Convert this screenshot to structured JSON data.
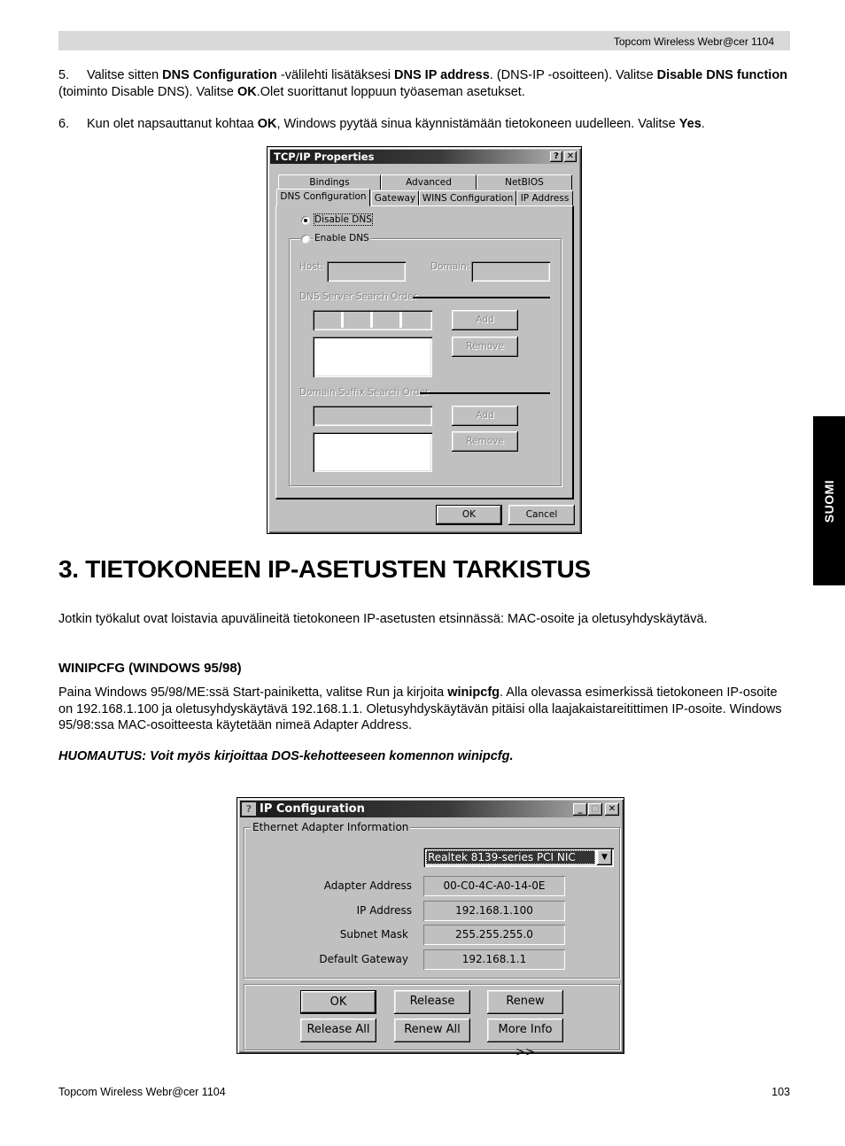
{
  "header": {
    "text": "Topcom Wireless Webr@cer 1104"
  },
  "side_tab": {
    "label": "SUOMI"
  },
  "steps": [
    {
      "number": "5.",
      "parts": [
        {
          "t": "Valitse sitten ",
          "b": false
        },
        {
          "t": "DNS Configuration",
          "b": true
        },
        {
          "t": " -välilehti lisätäksesi ",
          "b": false
        },
        {
          "t": "DNS IP address",
          "b": true
        },
        {
          "t": ". (DNS-IP -osoitteen). Valitse ",
          "b": false
        },
        {
          "t": "Disable DNS function",
          "b": true
        },
        {
          "t": " (toiminto Disable DNS). Valitse ",
          "b": false
        },
        {
          "t": "OK",
          "b": true
        },
        {
          "t": ".Olet suorittanut loppuun työaseman asetukset.",
          "b": false
        }
      ]
    },
    {
      "number": "6.",
      "parts": [
        {
          "t": "Kun olet napsauttanut kohtaa ",
          "b": false
        },
        {
          "t": "OK",
          "b": true
        },
        {
          "t": ", Windows pyytää sinua käynnistämään tietokoneen uudelleen. Valitse ",
          "b": false
        },
        {
          "t": "Yes",
          "b": true
        },
        {
          "t": ".",
          "b": false
        }
      ]
    }
  ],
  "tcpip_dialog": {
    "title": "TCP/IP Properties",
    "help_btn": "?",
    "close_btn": "✕",
    "tabs_back": [
      "Bindings",
      "Advanced",
      "NetBIOS"
    ],
    "tabs_front": [
      "DNS Configuration",
      "Gateway",
      "WINS Configuration",
      "IP Address"
    ],
    "active_tab": "DNS Configuration",
    "radio_disable": "Disable DNS",
    "radio_enable": "Enable DNS",
    "selected_radio": "Disable DNS",
    "host_label": "Host:",
    "host_value": "",
    "domain_label": "Domain:",
    "domain_value": "",
    "dns_server_label": "DNS Server Search Order",
    "ip_dots": [
      ".",
      ".",
      "."
    ],
    "add1": "Add",
    "remove1": "Remove",
    "suffix_label": "Domain Suffix Search Order",
    "add2": "Add",
    "remove2": "Remove",
    "ok": "OK",
    "cancel": "Cancel"
  },
  "section": {
    "title": "3. TIETOKONEEN IP-ASETUSTEN TARKISTUS",
    "intro": "Jotkin työkalut ovat loistavia apuvälineitä tietokoneen IP-asetusten etsinnässä: MAC-osoite ja oletusyhdyskäytävä.",
    "subheading": "WINIPCFG (WINDOWS 95/98)",
    "body_parts": [
      {
        "t": "Paina Windows 95/98/ME:ssä Start-painiketta, valitse Run ja kirjoita ",
        "b": false
      },
      {
        "t": "winipcfg",
        "b": true
      },
      {
        "t": ". Alla olevassa esimerkissä tietokoneen IP-osoite on 192.168.1.100 ja oletusyhdyskäytävä 192.168.1.1. Oletusyhdyskäytävän pitäisi olla laajakaistareitittimen IP-osoite. Windows 95/98:ssa MAC-osoitteesta käytetään nimeä Adapter Address.",
        "b": false
      }
    ],
    "note": "HUOMAUTUS: Voit myös kirjoittaa DOS-kehotteeseen komennon winipcfg."
  },
  "ipconfig_dialog": {
    "title": "IP Configuration",
    "minimize": "_",
    "maximize": "□",
    "close": "✕",
    "group_label": "Ethernet  Adapter Information",
    "adapter_selected": "Realtek 8139-series PCI NIC",
    "fields": [
      {
        "label": "Adapter Address",
        "value": "00-C0-4C-A0-14-0E"
      },
      {
        "label": "IP Address",
        "value": "192.168.1.100"
      },
      {
        "label": "Subnet Mask",
        "value": "255.255.255.0"
      },
      {
        "label": "Default Gateway",
        "value": "192.168.1.1"
      }
    ],
    "buttons": {
      "ok": "OK",
      "release": "Release",
      "renew": "Renew",
      "release_all": "Release All",
      "renew_all": "Renew All",
      "more_info": "More Info >>"
    }
  },
  "footer": {
    "left": "Topcom Wireless Webr@cer 1104",
    "page": "103"
  }
}
